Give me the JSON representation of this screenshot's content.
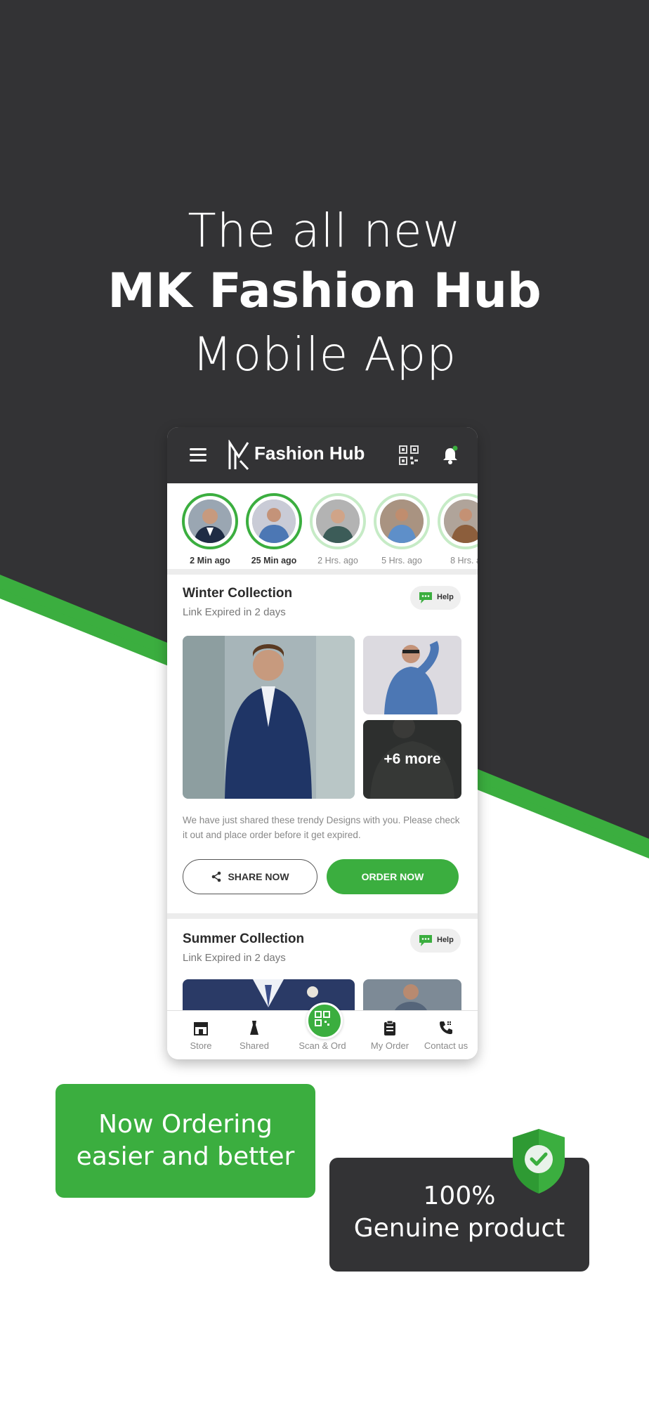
{
  "hero": {
    "line1": "The all new",
    "line2": "MK Fashion Hub",
    "line3": "Mobile App"
  },
  "colors": {
    "dark": "#333335",
    "accent_green": "#3bae3f",
    "light_green": "#c6ebc6"
  },
  "app": {
    "brand": "Fashion Hub",
    "header_icons": [
      "menu-icon",
      "mk-logo",
      "qr-code-icon",
      "bell-icon"
    ],
    "stories": [
      {
        "time": "2 Min ago",
        "active": true
      },
      {
        "time": "25 Min ago",
        "active": true
      },
      {
        "time": "2 Hrs. ago",
        "active": false
      },
      {
        "time": "5 Hrs. ago",
        "active": false
      },
      {
        "time": "8 Hrs. a",
        "active": false
      }
    ],
    "cards": [
      {
        "title": "Winter Collection",
        "subtitle": "Link Expired in 2 days",
        "help_label": "Help",
        "more_label": "+6 more",
        "description": "We have just shared these trendy Designs with you. Please check it out and place order before it get expired.",
        "share_label": "SHARE NOW",
        "order_label": "ORDER NOW"
      },
      {
        "title": "Summer Collection",
        "subtitle": "Link Expired in 2 days",
        "help_label": "Help"
      }
    ],
    "nav": [
      {
        "label": "Store",
        "icon": "store-icon"
      },
      {
        "label": "Shared",
        "icon": "dress-icon"
      },
      {
        "label": "Scan & Ord",
        "icon": "qr-scan-icon"
      },
      {
        "label": "My Order",
        "icon": "clipboard-icon"
      },
      {
        "label": "Contact us",
        "icon": "phone-icon"
      }
    ]
  },
  "badges": {
    "green_line1": "Now Ordering",
    "green_line2": "easier and better",
    "dark_line1": "100%",
    "dark_line2": "Genuine product"
  }
}
